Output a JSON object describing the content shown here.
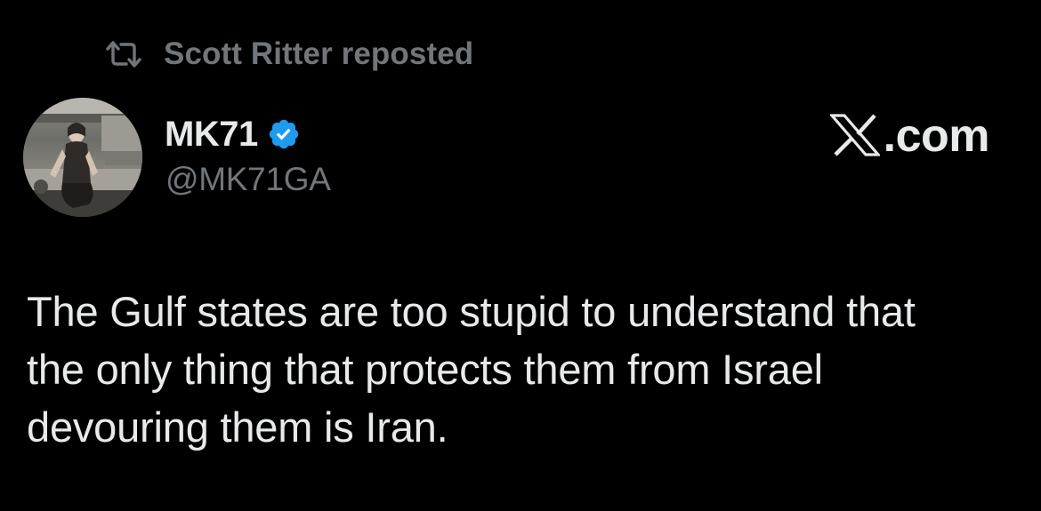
{
  "repost": {
    "icon": "repost-icon",
    "label": "Scott Ritter reposted"
  },
  "author": {
    "display_name": "MK71",
    "handle": "@MK71GA",
    "verified": true,
    "verified_icon": "verified-badge-icon",
    "avatar_icon": "avatar-photo"
  },
  "brand": {
    "logo_icon": "x-logo-icon",
    "suffix": ".com"
  },
  "post": {
    "lines": [
      "The Gulf states are too stupid to understand that",
      "the only thing that protects them from Israel",
      "devouring them is Iran."
    ]
  },
  "colors": {
    "background": "#000000",
    "primary_text": "#e7e9ea",
    "secondary_text": "#71767b",
    "verified_blue": "#1d9bf0"
  }
}
